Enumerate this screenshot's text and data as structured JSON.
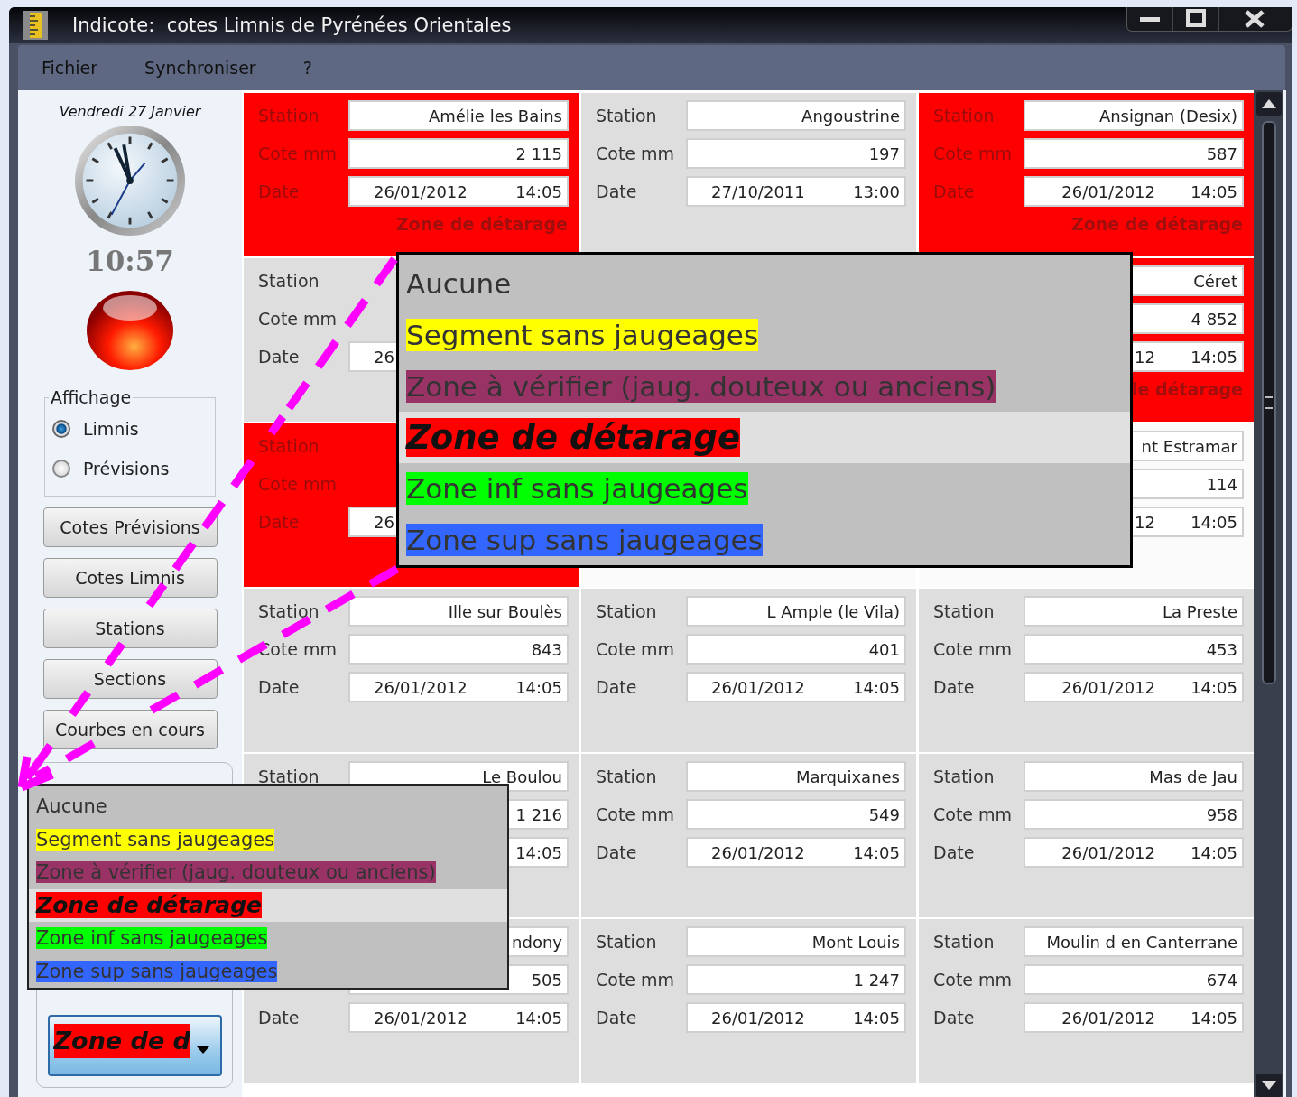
{
  "window": {
    "title": "Indicote:  cotes Limnis de Pyrénées Orientales"
  },
  "menu": [
    "Fichier",
    "Synchroniser",
    "?"
  ],
  "sidebar": {
    "date": "Vendredi 27 Janvier",
    "time": "10:57",
    "display_group": {
      "title": "Affichage",
      "options": [
        {
          "label": "Limnis",
          "selected": true
        },
        {
          "label": "Prévisions",
          "selected": false
        }
      ]
    },
    "buttons": [
      "Cotes Prévisions",
      "Cotes Limnis",
      "Stations",
      "Sections",
      "Courbes en cours"
    ],
    "zone_combo": {
      "value": "Zone de d",
      "color": "#ff0000"
    }
  },
  "grid": {
    "rows": [
      {
        "cards": [
          {
            "alert": true,
            "station_label": "Station",
            "station": "Amélie les Bains",
            "cote_label": "Cote mm",
            "cote": "2 115",
            "date_label": "Date",
            "date": "26/01/2012",
            "time": "14:05",
            "zone": "Zone de détarage"
          },
          {
            "alert": false,
            "station_label": "Station",
            "station": "Angoustrine",
            "cote_label": "Cote mm",
            "cote": "197",
            "date_label": "Date",
            "date": "27/10/2011",
            "time": "13:00"
          },
          {
            "alert": true,
            "station_label": "Station",
            "station": "Ansignan (Desix)",
            "cote_label": "Cote mm",
            "cote": "587",
            "date_label": "Date",
            "date": "26/01/2012",
            "time": "14:05",
            "zone": "Zone de détarage"
          }
        ]
      },
      {
        "cards": [
          {
            "alert": false,
            "station_label": "Station",
            "cote_label": "Cote mm",
            "date_label": "Date",
            "date": "26"
          },
          {
            "alert": true,
            "station": "Céret",
            "cote": "4 852",
            "date": "12",
            "time": "14:05",
            "zone": "le détarage"
          }
        ]
      },
      {
        "cards": [
          {
            "alert": true,
            "station_label": "Station",
            "cote_label": "Cote mm",
            "date_label": "Date",
            "date": "26"
          },
          {
            "alert": false,
            "highlighted": true
          },
          {
            "alert": false,
            "highlighted": true,
            "station": "nt Estramar",
            "cote": "114",
            "date": "12",
            "time": "14:05"
          }
        ]
      },
      {
        "cards": [
          {
            "alert": false,
            "station_label": "Station",
            "station": "Ille sur Boulès",
            "cote_label": "Cote mm",
            "cote": "843",
            "date_label": "Date",
            "date": "26/01/2012",
            "time": "14:05"
          },
          {
            "alert": false,
            "station_label": "Station",
            "station": "L Ample (le Vila)",
            "cote_label": "Cote mm",
            "cote": "401",
            "date_label": "Date",
            "date": "26/01/2012",
            "time": "14:05"
          },
          {
            "alert": false,
            "station_label": "Station",
            "station": "La Preste",
            "cote_label": "Cote mm",
            "cote": "453",
            "date_label": "Date",
            "date": "26/01/2012",
            "time": "14:05"
          }
        ]
      },
      {
        "cards": [
          {
            "alert": false,
            "station_label": "Station",
            "station": "Le Boulou",
            "cote": "1 216",
            "time": "14:05"
          },
          {
            "alert": false,
            "station_label": "Station",
            "station": "Marquixanes",
            "cote_label": "Cote mm",
            "cote": "549",
            "date_label": "Date",
            "date": "26/01/2012",
            "time": "14:05"
          },
          {
            "alert": false,
            "station_label": "Station",
            "station": "Mas de Jau",
            "cote_label": "Cote mm",
            "cote": "958",
            "date_label": "Date",
            "date": "26/01/2012",
            "time": "14:05"
          }
        ]
      },
      {
        "cards": [
          {
            "alert": false,
            "station": "ndony",
            "cote": "505",
            "date_label": "Date",
            "date": "26/01/2012",
            "time": "14:05"
          },
          {
            "alert": false,
            "station_label": "Station",
            "station": "Mont Louis",
            "cote_label": "Cote mm",
            "cote": "1 247",
            "date_label": "Date",
            "date": "26/01/2012",
            "time": "14:05"
          },
          {
            "alert": false,
            "station_label": "Station",
            "station": "Moulin d en Canterrane",
            "cote_label": "Cote mm",
            "cote": "674",
            "date_label": "Date",
            "date": "26/01/2012",
            "time": "14:05"
          }
        ]
      }
    ]
  },
  "zoomed_popup": {
    "items": [
      {
        "label": "Aucune",
        "selected": false
      },
      {
        "label": "Segment sans jaugeages",
        "color": "#ffff00",
        "selected": false
      },
      {
        "label": "Zone à vérifier (jaug. douteux ou anciens)",
        "color": "#993366",
        "selected": false
      },
      {
        "label": "Zone de détarage",
        "color": "#ff0000",
        "selected": true
      },
      {
        "label": "Zone inf sans jaugeages",
        "color": "#00ff00",
        "selected": false
      },
      {
        "label": "Zone sup sans jaugeages",
        "color": "#3366ff",
        "selected": false
      }
    ]
  },
  "zone_popup": {
    "items": [
      {
        "label": "Aucune",
        "selected": false
      },
      {
        "label": "Segment sans jaugeages",
        "color": "#ffff00",
        "selected": false
      },
      {
        "label": "Zone à vérifier (jaug. douteux ou anciens)",
        "color": "#993366",
        "selected": false
      },
      {
        "label": "Zone de détarage",
        "color": "#ff0000",
        "selected": true
      },
      {
        "label": "Zone inf sans jaugeages",
        "color": "#00ff00",
        "selected": false
      },
      {
        "label": "Zone sup sans jaugeages",
        "color": "#3366ff",
        "selected": false
      }
    ]
  }
}
